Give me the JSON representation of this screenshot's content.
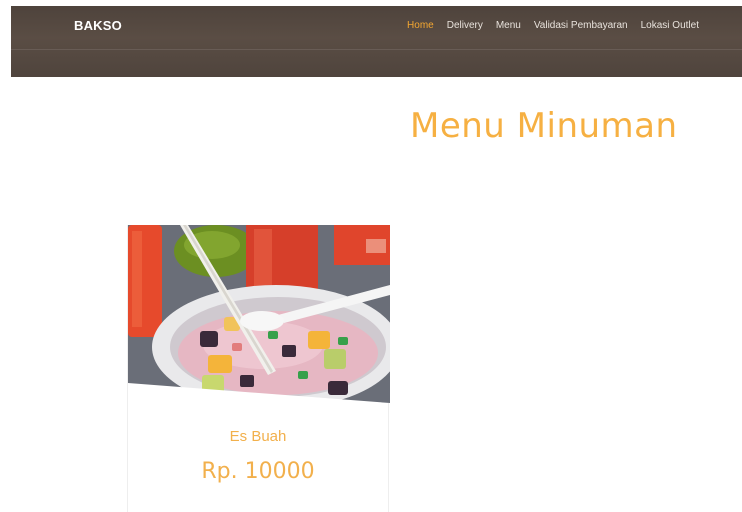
{
  "navbar": {
    "brand": "BAKSO",
    "items": [
      {
        "label": "Home",
        "active": true
      },
      {
        "label": "Delivery",
        "active": false
      },
      {
        "label": "Menu",
        "active": false
      },
      {
        "label": "Validasi Pembayaran",
        "active": false
      },
      {
        "label": "Lokasi Outlet",
        "active": false
      }
    ]
  },
  "section": {
    "title": "Menu Minuman"
  },
  "products": [
    {
      "name": "Es Buah",
      "price": "Rp. 10000",
      "image_icon": "es-buah-photo"
    }
  ],
  "colors": {
    "navbar_bg": "#54483f",
    "accent": "#f4a731",
    "title": "#f6b042",
    "nav_text": "#e8e2dc"
  }
}
